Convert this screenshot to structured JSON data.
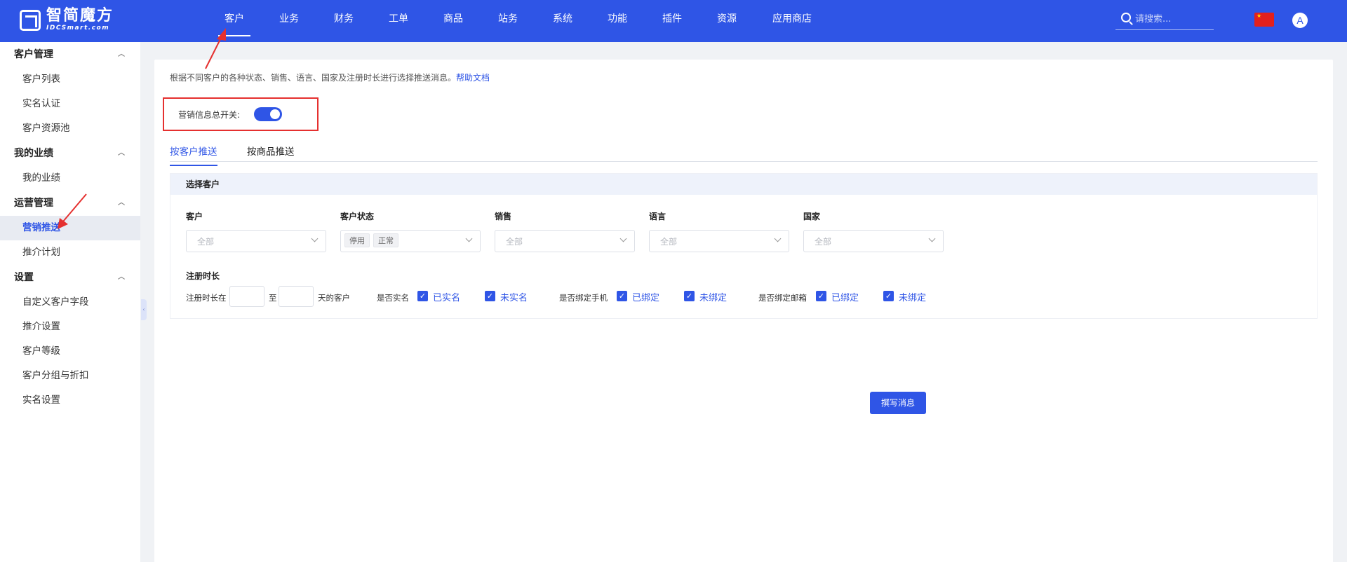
{
  "brand": {
    "name": "智简魔方",
    "sub": "IDCSmart.com"
  },
  "nav": [
    "客户",
    "业务",
    "财务",
    "工单",
    "商品",
    "站务",
    "系统",
    "功能",
    "插件",
    "资源",
    "应用商店"
  ],
  "search": {
    "placeholder": "请搜索..."
  },
  "user": {
    "avatar_letter": "A"
  },
  "sidebar": {
    "groups": [
      {
        "title": "客户管理",
        "items": [
          "客户列表",
          "实名认证",
          "客户资源池"
        ]
      },
      {
        "title": "我的业绩",
        "items": [
          "我的业绩"
        ]
      },
      {
        "title": "运营管理",
        "items": [
          "营销推送",
          "推介计划"
        ]
      },
      {
        "title": "设置",
        "items": [
          "自定义客户字段",
          "推介设置",
          "客户等级",
          "客户分组与折扣",
          "实名设置"
        ]
      }
    ]
  },
  "main": {
    "intro": "根据不同客户的各种状态、销售、语言、国家及注册时长进行选择推送消息。",
    "help_link": "帮助文档",
    "master_switch_label": "营销信息总开关:",
    "tabs": [
      "按客户推送",
      "按商品推送"
    ],
    "filter": {
      "section_title": "选择客户",
      "fields": [
        {
          "label": "客户",
          "placeholder": "全部"
        },
        {
          "label": "客户状态",
          "tags": [
            "停用",
            "正常"
          ]
        },
        {
          "label": "销售",
          "placeholder": "全部"
        },
        {
          "label": "语言",
          "placeholder": "全部"
        },
        {
          "label": "国家",
          "placeholder": "全部"
        }
      ],
      "reg_title": "注册时长",
      "reg_prefix": "注册时长在",
      "reg_mid": "至",
      "reg_suffix": "天的客户",
      "realname_label": "是否实名",
      "realname_yes": "已实名",
      "realname_no": "未实名",
      "phone_label": "是否绑定手机",
      "phone_yes": "已绑定",
      "phone_no": "未绑定",
      "email_label": "是否绑定邮箱",
      "email_yes": "已绑定",
      "email_no": "未绑定"
    },
    "write_button": "撰写消息"
  }
}
